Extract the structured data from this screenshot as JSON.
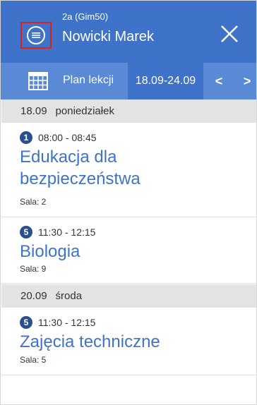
{
  "header": {
    "class_label": "2a (Gim50)",
    "student_name": "Nowicki Marek"
  },
  "toolbar": {
    "plan_label": "Plan lekcji",
    "date_range": "18.09-24.09",
    "prev_label": "<",
    "next_label": ">"
  },
  "days": [
    {
      "date": "18.09",
      "weekday": "poniedziałek",
      "lessons": [
        {
          "number": "1",
          "time": "08:00 - 08:45",
          "subject_line1": "Edukacja dla",
          "subject_line2": "bezpieczeństwa",
          "room": "Sala: 2"
        },
        {
          "number": "5",
          "time": "11:30 - 12:15",
          "subject_line1": "Biologia",
          "room": "Sala: 9"
        }
      ]
    },
    {
      "date": "20.09",
      "weekday": "środa",
      "lessons": [
        {
          "number": "5",
          "time": "11:30 - 12:15",
          "subject_line1": "Zajęcia techniczne",
          "room": "Sala: 5"
        }
      ]
    }
  ],
  "icons": {
    "menu": "menu-icon",
    "close": "close-icon",
    "calendar": "calendar-icon"
  },
  "colors": {
    "header_bg": "#3f73c9",
    "toolbar_bg": "#5a8ad6",
    "badge_bg": "#2a4f8f",
    "subject_text": "#3f73c9",
    "day_header_bg": "#e3e3e3",
    "highlight_border": "#e02020"
  }
}
